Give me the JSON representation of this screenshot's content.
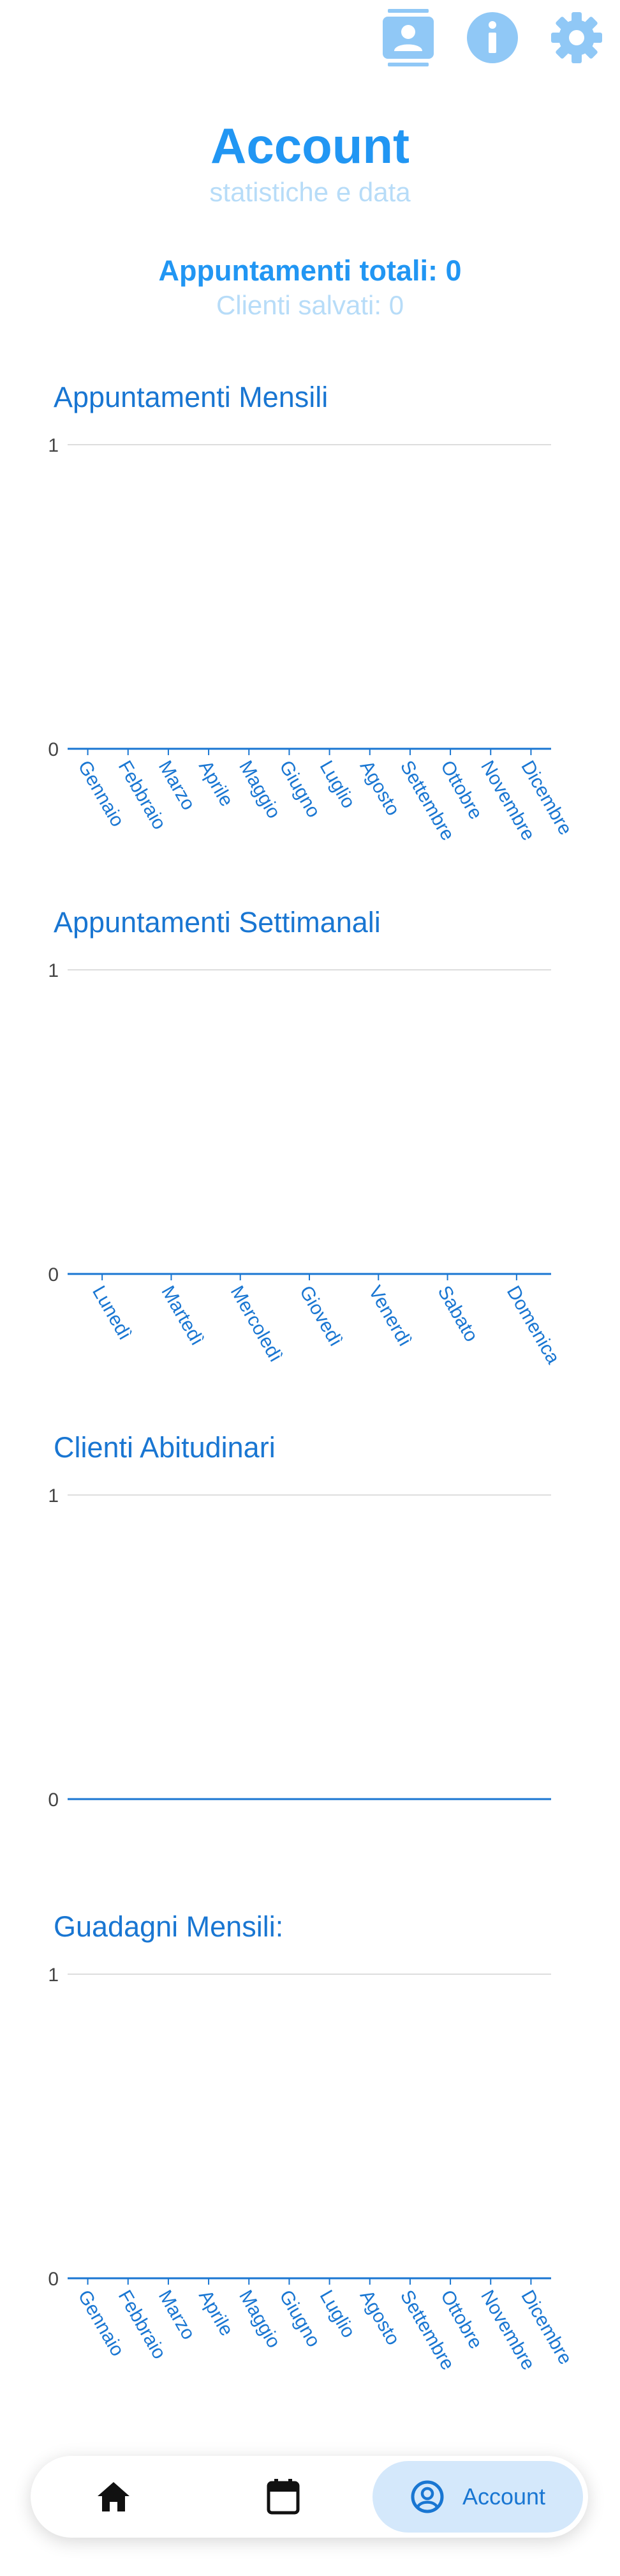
{
  "header": {
    "title": "Account",
    "subtitle": "statistiche e data"
  },
  "top_actions": [
    {
      "name": "contacts-icon",
      "color": "#90c8f6"
    },
    {
      "name": "info-icon",
      "color": "#90c8f6"
    },
    {
      "name": "settings-icon",
      "color": "#90c8f6"
    }
  ],
  "stats": {
    "total_appointments": "Appuntamenti totali: 0",
    "saved_clients": "Clienti salvati: 0"
  },
  "colors": {
    "primary": "#2196f3",
    "primary_light": "#b7dcf8",
    "section_title": "#1976d2",
    "axis_line": "#1976d2",
    "grid_line": "#dddddd",
    "nav_active_bg": "#d4e8fb"
  },
  "chart_data": [
    {
      "type": "bar",
      "title": "Appuntamenti Mensili",
      "categories": [
        "Gennaio",
        "Febbraio",
        "Marzo",
        "Aprile",
        "Maggio",
        "Giugno",
        "Luglio",
        "Agosto",
        "Settembre",
        "Ottobre",
        "Novembre",
        "Dicembre"
      ],
      "values": [
        0,
        0,
        0,
        0,
        0,
        0,
        0,
        0,
        0,
        0,
        0,
        0
      ],
      "ylim": [
        0,
        1
      ],
      "yticks": [
        "0",
        "1"
      ],
      "grid": true
    },
    {
      "type": "bar",
      "title": "Appuntamenti Settimanali",
      "categories": [
        "Lunedì",
        "Martedì",
        "Mercoledì",
        "Giovedì",
        "Venerdì",
        "Sabato",
        "Domenica"
      ],
      "values": [
        0,
        0,
        0,
        0,
        0,
        0,
        0
      ],
      "ylim": [
        0,
        1
      ],
      "yticks": [
        "0",
        "1"
      ],
      "grid": true
    },
    {
      "type": "bar",
      "title": "Clienti Abitudinari",
      "categories": [],
      "values": [],
      "ylim": [
        0,
        1
      ],
      "yticks": [
        "0",
        "1"
      ],
      "grid": true
    },
    {
      "type": "bar",
      "title": "Guadagni Mensili:",
      "categories": [
        "Gennaio",
        "Febbraio",
        "Marzo",
        "Aprile",
        "Maggio",
        "Giugno",
        "Luglio",
        "Agosto",
        "Settembre",
        "Ottobre",
        "Novembre",
        "Dicembre"
      ],
      "values": [
        0,
        0,
        0,
        0,
        0,
        0,
        0,
        0,
        0,
        0,
        0,
        0
      ],
      "ylim": [
        0,
        1
      ],
      "yticks": [
        "0",
        "1"
      ],
      "grid": true
    }
  ],
  "bottom_nav": {
    "items": [
      {
        "icon": "home-icon",
        "label": ""
      },
      {
        "icon": "calendar-icon",
        "label": ""
      },
      {
        "icon": "account-circle-icon",
        "label": "Account",
        "active": true
      }
    ]
  }
}
